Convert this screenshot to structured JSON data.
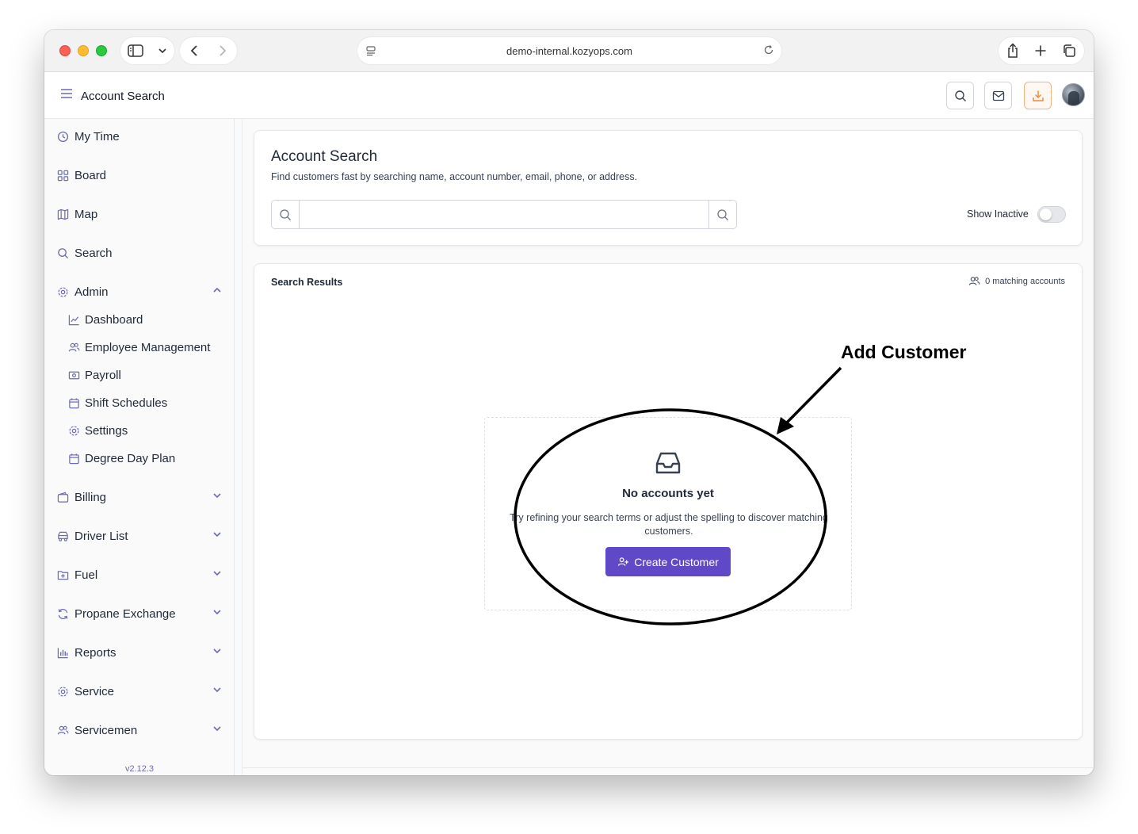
{
  "browser": {
    "url": "demo-internal.kozyops.com"
  },
  "header": {
    "title": "Account Search"
  },
  "sidebar": {
    "items": [
      {
        "label": "My Time",
        "icon": "clock-icon"
      },
      {
        "label": "Board",
        "icon": "grid-icon"
      },
      {
        "label": "Map",
        "icon": "map-icon"
      },
      {
        "label": "Search",
        "icon": "search-icon"
      },
      {
        "label": "Admin",
        "icon": "gear-icon",
        "expanded": true
      },
      {
        "label": "Billing",
        "icon": "wallet-icon"
      },
      {
        "label": "Driver List",
        "icon": "truck-icon"
      },
      {
        "label": "Fuel",
        "icon": "folder-plus-icon"
      },
      {
        "label": "Propane Exchange",
        "icon": "refresh-icon"
      },
      {
        "label": "Reports",
        "icon": "bar-chart-icon"
      },
      {
        "label": "Service",
        "icon": "gear-icon"
      },
      {
        "label": "Servicemen",
        "icon": "users-icon"
      }
    ],
    "admin_subitems": [
      {
        "label": "Dashboard",
        "icon": "line-chart-icon"
      },
      {
        "label": "Employee Management",
        "icon": "users-icon"
      },
      {
        "label": "Payroll",
        "icon": "cash-icon"
      },
      {
        "label": "Shift Schedules",
        "icon": "calendar-icon"
      },
      {
        "label": "Settings",
        "icon": "gear-icon"
      },
      {
        "label": "Degree Day Plan",
        "icon": "calendar-icon"
      }
    ],
    "version": "v2.12.3"
  },
  "search_card": {
    "title": "Account Search",
    "subtitle": "Find customers fast by searching name, account number, email, phone, or address.",
    "input_value": "",
    "input_placeholder": "",
    "show_inactive_label": "Show Inactive",
    "show_inactive": false
  },
  "results_card": {
    "title": "Search Results",
    "count_text": "0 matching accounts",
    "empty_title": "No accounts yet",
    "empty_description": "Try refining your search terms or adjust the spelling to discover matching customers.",
    "create_button": "Create Customer"
  },
  "annotation": {
    "label": "Add Customer"
  },
  "colors": {
    "accent": "#6049c6",
    "icon": "#6b6bb5",
    "download_accent": "#f08a3c"
  }
}
